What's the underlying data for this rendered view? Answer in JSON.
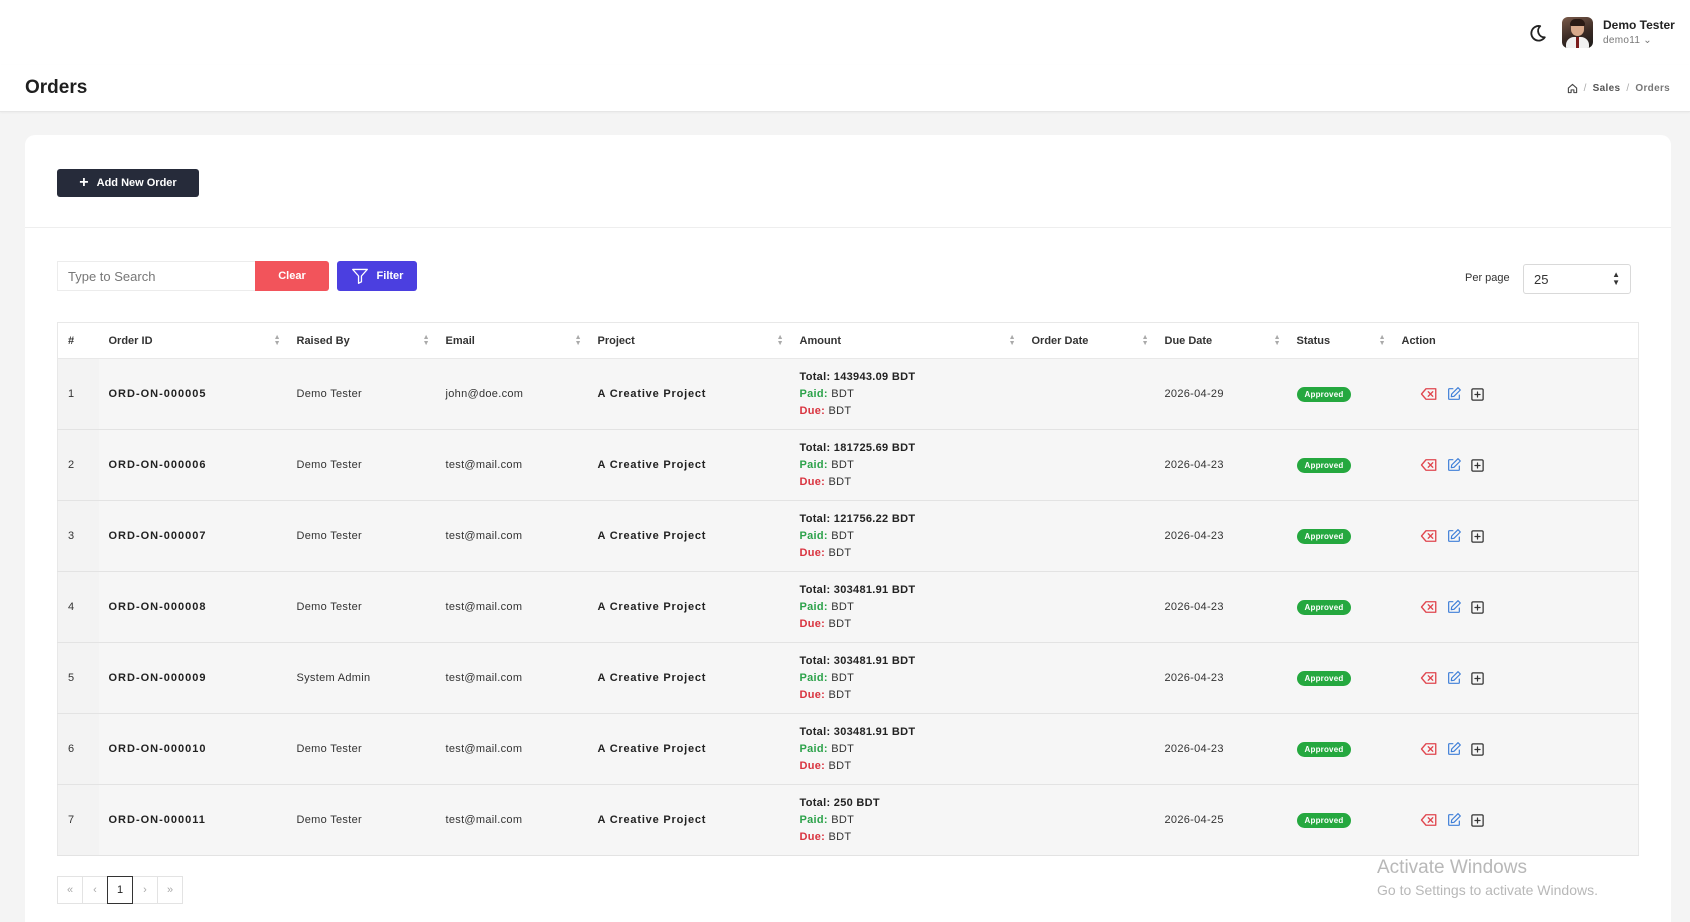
{
  "header": {
    "user_name": "Demo Tester",
    "user_sub": "demo11 ⌄"
  },
  "page": {
    "title": "Orders",
    "breadcrumb": [
      "Sales",
      "Orders"
    ]
  },
  "toolbar": {
    "add_label": "Add New Order",
    "search_placeholder": "Type to Search",
    "clear_label": "Clear",
    "filter_label": "Filter",
    "per_page_label": "Per page",
    "per_page_value": "25"
  },
  "table": {
    "columns": [
      "#",
      "Order ID",
      "Raised By",
      "Email",
      "Project",
      "Amount",
      "Order Date",
      "Due Date",
      "Status",
      "Action"
    ],
    "paid_label": "Paid:",
    "due_label": "Due:",
    "rows": [
      {
        "n": "1",
        "id": "ORD-ON-000005",
        "raised_by": "Demo Tester",
        "email": "john@doe.com",
        "project": "A Creative Project",
        "total": "Total: 143943.09 BDT",
        "paid": "BDT",
        "due": "BDT",
        "order_date": "",
        "due_date": "2026-04-29",
        "status": "Approved"
      },
      {
        "n": "2",
        "id": "ORD-ON-000006",
        "raised_by": "Demo Tester",
        "email": "test@mail.com",
        "project": "A Creative Project",
        "total": "Total: 181725.69 BDT",
        "paid": "BDT",
        "due": "BDT",
        "order_date": "",
        "due_date": "2026-04-23",
        "status": "Approved"
      },
      {
        "n": "3",
        "id": "ORD-ON-000007",
        "raised_by": "Demo Tester",
        "email": "test@mail.com",
        "project": "A Creative Project",
        "total": "Total: 121756.22 BDT",
        "paid": "BDT",
        "due": "BDT",
        "order_date": "",
        "due_date": "2026-04-23",
        "status": "Approved"
      },
      {
        "n": "4",
        "id": "ORD-ON-000008",
        "raised_by": "Demo Tester",
        "email": "test@mail.com",
        "project": "A Creative Project",
        "total": "Total: 303481.91 BDT",
        "paid": "BDT",
        "due": "BDT",
        "order_date": "",
        "due_date": "2026-04-23",
        "status": "Approved"
      },
      {
        "n": "5",
        "id": "ORD-ON-000009",
        "raised_by": "System Admin",
        "email": "test@mail.com",
        "project": "A Creative Project",
        "total": "Total: 303481.91 BDT",
        "paid": "BDT",
        "due": "BDT",
        "order_date": "",
        "due_date": "2026-04-23",
        "status": "Approved"
      },
      {
        "n": "6",
        "id": "ORD-ON-000010",
        "raised_by": "Demo Tester",
        "email": "test@mail.com",
        "project": "A Creative Project",
        "total": "Total: 303481.91 BDT",
        "paid": "BDT",
        "due": "BDT",
        "order_date": "",
        "due_date": "2026-04-23",
        "status": "Approved"
      },
      {
        "n": "7",
        "id": "ORD-ON-000011",
        "raised_by": "Demo Tester",
        "email": "test@mail.com",
        "project": "A Creative Project",
        "total": "Total: 250 BDT",
        "paid": "BDT",
        "due": "BDT",
        "order_date": "",
        "due_date": "2026-04-25",
        "status": "Approved"
      }
    ]
  },
  "pagination": {
    "first": "«",
    "prev": "‹",
    "current": "1",
    "next": "›",
    "last": "»"
  },
  "watermark": {
    "line1": "Activate Windows",
    "line2": "Go to Settings to activate Windows."
  },
  "colors": {
    "primary_dark": "#262b3a",
    "clear": "#f2545b",
    "filter": "#4b3fe0",
    "approved": "#25a83f",
    "paid": "#2ca24a",
    "due": "#d9333f",
    "delete_icon": "#e0474f",
    "edit_icon": "#3f7fd8"
  },
  "icons": {
    "theme_toggle": "moon-icon",
    "home": "home-icon",
    "add": "plus-icon",
    "filter": "funnel-icon",
    "delete": "delete-backspace-icon",
    "edit": "edit-pencil-icon",
    "view": "plus-square-icon"
  }
}
